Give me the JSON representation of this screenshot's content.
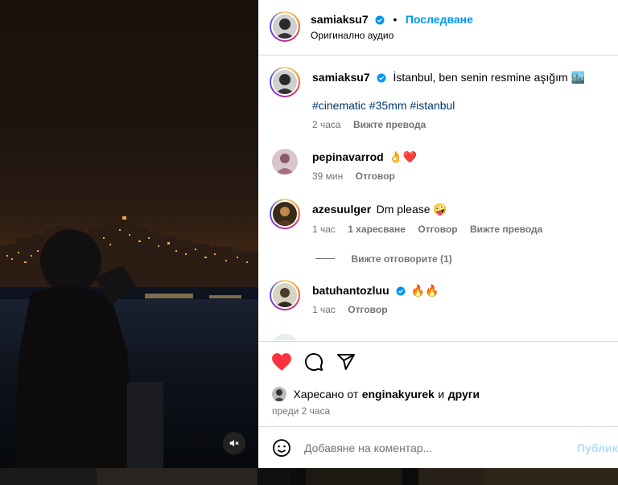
{
  "header": {
    "username": "samiaksu7",
    "follow_label": "Последване",
    "separator": "•",
    "audio": "Оригинално аудио"
  },
  "caption": {
    "username": "samiaksu7",
    "text": "İstanbul, ben senin resmine aşığım 🏙️",
    "hashtags": "#cinematic #35mm #istanbul",
    "time": "2 часа",
    "translate": "Вижте превода"
  },
  "comments": [
    {
      "username": "pepinavarrod",
      "text": "👌❤️",
      "time": "39 мин",
      "reply": "Отговор"
    },
    {
      "username": "azesuulger",
      "text": "Dm please 🤪",
      "time": "1 час",
      "likes": "1 харесване",
      "reply": "Отговор",
      "translate": "Вижте превода",
      "view_replies": "Вижте отговорите (1)"
    },
    {
      "username": "batuhantozluu",
      "text": "🔥🔥",
      "time": "1 час",
      "reply": "Отговор"
    }
  ],
  "actions": {
    "liked_by_prefix": "Харесано от",
    "liked_by_user": "enginakyurek",
    "liked_by_and": "и",
    "liked_by_others": "други",
    "timestamp": "преди 2 часа"
  },
  "add_comment": {
    "placeholder": "Добавяне на коментар...",
    "post_label": "Публик"
  },
  "colors": {
    "accent": "#0095f6",
    "like": "#ff3040",
    "hashtag": "#00376b"
  }
}
